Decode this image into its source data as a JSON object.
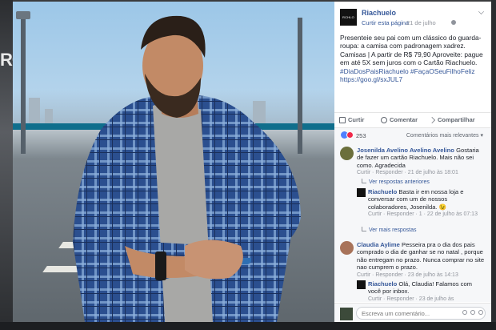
{
  "background": {
    "partial_letters": "RO"
  },
  "post": {
    "page_name": "Riachuelo",
    "logo_text": "RCHLO",
    "like_page": "Curtir esta página",
    "date": "21 de julho",
    "text": "Presenteie seu pai com um clássico do guarda-roupa: a camisa com padronagem xadrez. Camisas | A partir de R$ 79,90 Aproveite: pague em até 5X sem juros com o Cartão Riachuelo.",
    "hashtags": "#DiaDosPaisRiachuelo #FaçaOSeuFilhoFeliz",
    "link": "https://goo.gl/sxJUL7"
  },
  "actions": {
    "like": "Curtir",
    "comment": "Comentar",
    "share": "Compartilhar"
  },
  "reactions": {
    "count": "253",
    "sort": "Comentários mais relevantes"
  },
  "comments": [
    {
      "author": "Josenilda Avelino Avelino Avelino",
      "text": "Gostaria de fazer um cartão Riachuelo. Mais não sei como. Agradecida",
      "actions": "Curtir · Responder · 21 de julho às 18:01",
      "more_replies": "Ver respostas anteriores"
    },
    {
      "author": "Riachuelo",
      "text": "Basta ir em nossa loja e conversar com um de nossos colaboradores, Josenilda. 😉",
      "actions": "Curtir · Responder · 1 · 22 de julho às 07:13",
      "more_replies": "Ver mais respostas"
    },
    {
      "author": "Claudia Aylime",
      "text": "Pesseira pra o dia dos pais comprado o dia de ganhar se no natal , porque não entregam no prazo. Nunca comprar no site nao cumprem o prazo.",
      "actions": "Curtir · Responder · 23 de julho às 14:13"
    },
    {
      "author": "Riachuelo",
      "text": "Olá, Claudia! Falamos com você por inbox.",
      "actions": "Curtir · Responder · 23 de julho às"
    }
  ],
  "composer": {
    "placeholder": "Escreva um comentário..."
  },
  "colors": {
    "link": "#365899",
    "panel_bg": "#f6f7f9",
    "like_blue": "#4f80ff",
    "love_red": "#f0284a"
  }
}
